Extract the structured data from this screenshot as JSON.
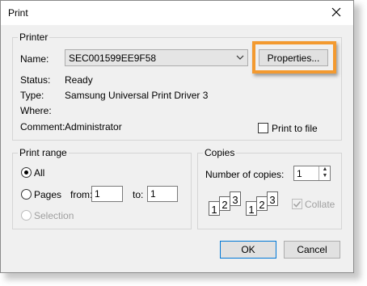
{
  "window": {
    "title": "Print"
  },
  "printer": {
    "group_label": "Printer",
    "name_label": "Name:",
    "name_value": "SEC001599EE9F58",
    "properties_button": "Properties...",
    "status_label": "Status:",
    "status_value": "Ready",
    "type_label": "Type:",
    "type_value": "Samsung Universal Print Driver 3",
    "where_label": "Where:",
    "where_value": "",
    "comment_label": "Comment:",
    "comment_value": "Administrator",
    "print_to_file_label": "Print to file"
  },
  "print_range": {
    "group_label": "Print range",
    "all_label": "All",
    "pages_label": "Pages",
    "from_label": "from:",
    "from_value": "1",
    "to_label": "to:",
    "to_value": "1",
    "selection_label": "Selection"
  },
  "copies": {
    "group_label": "Copies",
    "number_label": "Number of copies:",
    "number_value": "1",
    "collate_label": "Collate",
    "collate_icon_numbers": [
      "1",
      "2",
      "3"
    ]
  },
  "footer": {
    "ok_button": "OK",
    "cancel_button": "Cancel"
  },
  "colors": {
    "highlight": "#f39a30"
  }
}
